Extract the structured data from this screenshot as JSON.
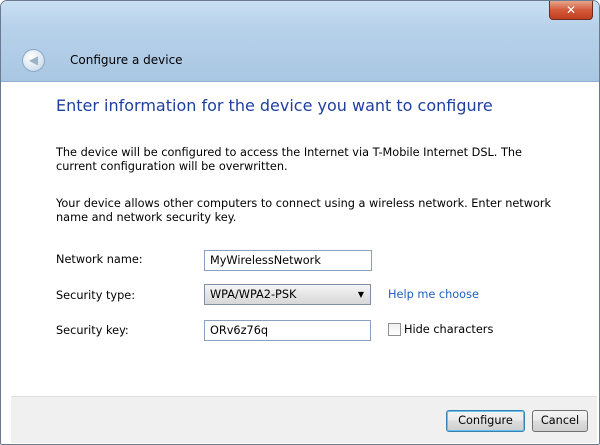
{
  "window": {
    "title": "Configure a device",
    "close_glyph": "✕",
    "back_icon": "back-arrow-icon"
  },
  "main": {
    "heading": "Enter information for the device you want to configure",
    "paragraph1": "The device will be configured to access the Internet via T-Mobile Internet DSL. The current configuration will be overwritten.",
    "paragraph2": "Your device allows other computers to connect using a wireless network. Enter network name and network security key."
  },
  "form": {
    "network_name_label": "Network name:",
    "network_name_value": "MyWirelessNetwork",
    "security_type_label": "Security type:",
    "security_type_value": "WPA/WPA2-PSK",
    "help_link": "Help me choose",
    "security_key_label": "Security key:",
    "security_key_value": "ORv6z76q",
    "hide_characters_label": "Hide characters",
    "hide_characters_checked": false
  },
  "footer": {
    "configure_label": "Configure",
    "cancel_label": "Cancel"
  },
  "colors": {
    "heading": "#1f3f9f",
    "link": "#1f5fbf",
    "close_button": "#c84a2c"
  }
}
